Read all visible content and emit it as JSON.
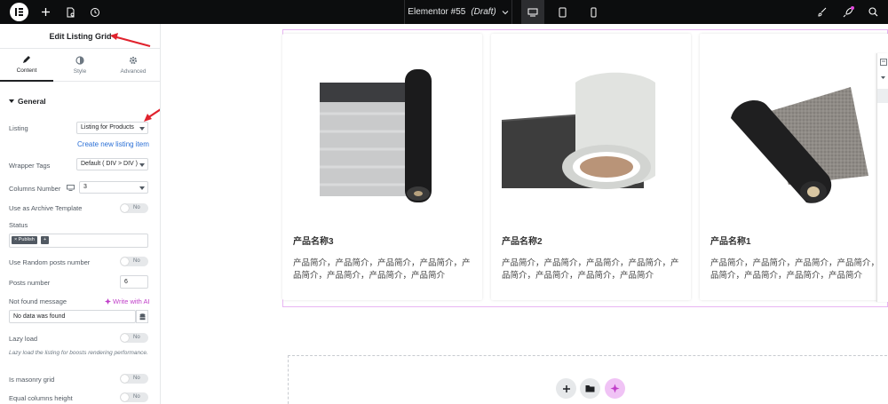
{
  "topbar": {
    "doc_title": "Elementor #55",
    "doc_status": "(Draft)"
  },
  "panel": {
    "title": "Edit Listing Grid",
    "tabs": [
      "Content",
      "Style",
      "Advanced"
    ],
    "section": "General",
    "listing": {
      "label": "Listing",
      "value": "Listing for Products"
    },
    "create_link": "Create new listing item",
    "wrapper": {
      "label": "Wrapper Tags",
      "value": "Default ( DIV > DIV )"
    },
    "columns": {
      "label": "Columns Number",
      "value": "3"
    },
    "archive": {
      "label": "Use as Archive Template",
      "toggle": "No"
    },
    "status": {
      "label": "Status",
      "tag": "× Publish",
      "add": "+"
    },
    "random": {
      "label": "Use Random posts number",
      "toggle": "No"
    },
    "posts": {
      "label": "Posts number",
      "value": "6"
    },
    "not_found": {
      "label": "Not found message",
      "ai": "Write with AI",
      "value": "No data was found"
    },
    "lazy": {
      "label": "Lazy load",
      "toggle": "No",
      "note": "Lazy load the listing for boosts rendering performance."
    },
    "masonry": {
      "label": "Is masonry grid",
      "toggle": "No"
    },
    "equal": {
      "label": "Equal columns height",
      "toggle": "No"
    }
  },
  "cards": [
    {
      "title": "产品名称3",
      "desc": "产品简介，产品简介，产品简介，产品简介，产品简介，产品简介，产品简介，产品简介"
    },
    {
      "title": "产品名称2",
      "desc": "产品简介，产品简介，产品简介，产品简介，产品简介，产品简介，产品简介，产品简介"
    },
    {
      "title": "产品名称1",
      "desc": "产品简介，产品简介，产品简介，产品简介，产品简介，产品简介，产品简介，产品简介"
    }
  ],
  "colors": {
    "accent": "#e8b6f3",
    "link": "#2a6fd6",
    "ai": "#c03ec9",
    "topbar": "#0c0d0e"
  }
}
